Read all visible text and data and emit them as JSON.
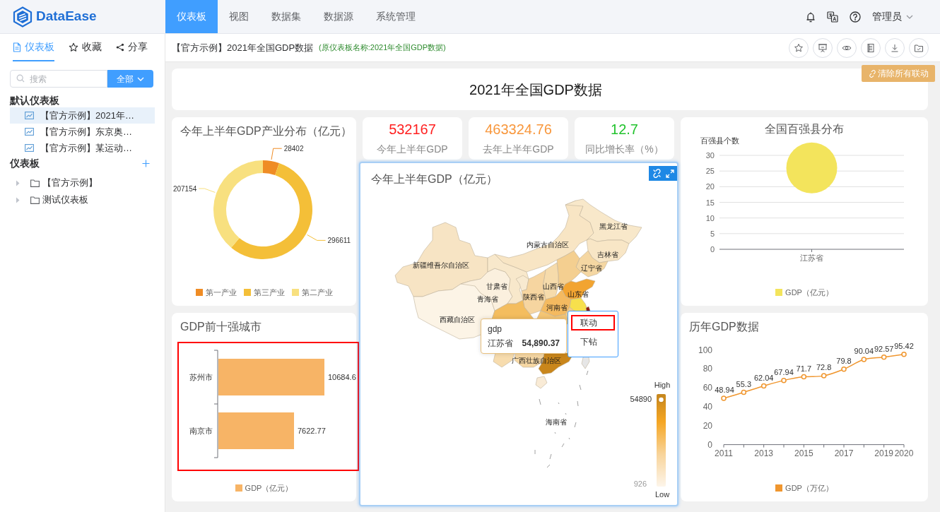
{
  "app": {
    "logo": "DataEase"
  },
  "nav": {
    "tabs": [
      {
        "label": "仪表板",
        "selected": true
      },
      {
        "label": "视图",
        "selected": false
      },
      {
        "label": "数据集",
        "selected": false
      },
      {
        "label": "数据源",
        "selected": false
      },
      {
        "label": "系统管理",
        "selected": false
      }
    ],
    "user": "管理员"
  },
  "sidebar": {
    "tabs": [
      {
        "label": "仪表板",
        "selected": true
      },
      {
        "label": "收藏",
        "selected": false
      },
      {
        "label": "分享",
        "selected": false
      }
    ],
    "search": {
      "placeholder": "搜索"
    },
    "filter_button": "全部",
    "default_section": {
      "title": "默认仪表板",
      "items": [
        {
          "label": "【官方示例】2021年…",
          "selected": true
        },
        {
          "label": "【官方示例】东京奥…",
          "selected": false
        },
        {
          "label": "【官方示例】某运动…",
          "selected": false
        }
      ]
    },
    "tree_section": {
      "title": "仪表板",
      "items": [
        {
          "label": "【官方示例】",
          "expanded": false
        },
        {
          "label": "测试仪表板",
          "expanded": false
        }
      ]
    }
  },
  "header": {
    "title": "【官方示例】2021年全国GDP数据",
    "original_name": "(原仪表板名称:2021年全国GDP数据)"
  },
  "dashboard": {
    "clear_linkage_button": "清除所有联动",
    "title": "2021年全国GDP数据",
    "kpis": [
      {
        "value": "532167",
        "label": "今年上半年GDP",
        "color": "#ff1f1f"
      },
      {
        "value": "463324.76",
        "label": "去年上半年GDP",
        "color": "#f8973c"
      },
      {
        "value": "12.7",
        "label": "同比增长率（%）",
        "color": "#22c32e"
      }
    ],
    "donut": {
      "chart_data": {
        "type": "donut",
        "title": "今年上半年GDP产业分布（亿元）",
        "categories": [
          "第一产业",
          "第三产业",
          "第二产业"
        ],
        "values": [
          28402,
          296611,
          207154
        ],
        "data_labels": true
      }
    },
    "county_chart": {
      "chart_data": {
        "type": "scatter",
        "title": "全国百强县分布",
        "ylabel": "百强县个数",
        "categories": [
          "江苏省"
        ],
        "series": [
          {
            "name": "GDP（亿元）",
            "color": "#f3e45c",
            "values": [
              26
            ]
          }
        ],
        "ylim": [
          0,
          30
        ],
        "yticks": [
          0,
          5,
          10,
          15,
          20,
          25,
          30
        ],
        "grid": true
      }
    },
    "map": {
      "title": "今年上半年GDP（亿元）",
      "selected": true,
      "regions": [
        {
          "label": "新疆维吾尔自治区",
          "color": "#f7e4c4"
        },
        {
          "label": "西藏自治区",
          "color": "#fcf4e6"
        },
        {
          "label": "青海省",
          "color": "#fbf0de"
        },
        {
          "label": "甘肃省",
          "color": "#f8e8cb"
        },
        {
          "label": "内蒙古自治区",
          "color": "#f8e5c4"
        },
        {
          "label": "黑龙江省",
          "color": "#f8e8ca"
        },
        {
          "label": "吉林省",
          "color": "#f8e6c6"
        },
        {
          "label": "辽宁省",
          "color": "#f5d7a2"
        },
        {
          "color": "#f4cf90"
        },
        {
          "color": "#f8ead0"
        },
        {
          "label": "山西省",
          "color": "#f6dbab"
        },
        {
          "label": "陕西省",
          "color": "#f6d5a0"
        },
        {
          "label": "山东省",
          "color": "#f2a431"
        },
        {
          "label": "河南省",
          "color": "#f4ba60"
        },
        {
          "color": "#f7e04c"
        },
        {
          "color": "#8c1c13"
        },
        {
          "color": "#f5cc85"
        },
        {
          "color": "#f5c674"
        },
        {
          "color": "#f4bd5e"
        },
        {
          "color": "#f7dcae"
        },
        {
          "label": "广西壮族自治区",
          "color": "#f6d7a3"
        },
        {
          "color": "#c9861b"
        },
        {
          "label": "海南省",
          "color": "#f9ebd6"
        },
        {
          "color": "#e6e6e6"
        }
      ],
      "visual_map": {
        "high": "High",
        "low": "Low",
        "max_label": "54890",
        "min_label": "926"
      },
      "tooltip": {
        "title": "gdp",
        "name": "江苏省",
        "value": "54,890.37"
      },
      "context_menu": [
        {
          "label": "联动",
          "highlighted": true
        },
        {
          "label": "下钻",
          "highlighted": false
        }
      ]
    },
    "city_bar": {
      "highlighted": true,
      "chart_data": {
        "type": "bar",
        "orientation": "horizontal",
        "title": "GDP前十强城市",
        "categories": [
          "苏州市",
          "南京市"
        ],
        "series": [
          {
            "name": "GDP（亿元）",
            "color": "#f7b466",
            "values": [
              10684.6,
              7622.77
            ]
          }
        ],
        "data_labels": true
      }
    },
    "history_line": {
      "chart_data": {
        "type": "line",
        "title": "历年GDP数据",
        "x": [
          2011,
          2012,
          2013,
          2014,
          2015,
          2016,
          2017,
          2018,
          2019,
          2020
        ],
        "series": [
          {
            "name": "GDP（万亿）",
            "color": "#f0962e",
            "marker": "circle",
            "values": [
              48.94,
              55.3,
              62.04,
              67.94,
              71.7,
              72.8,
              79.8,
              90.04,
              92.57,
              95.42
            ]
          }
        ],
        "xlim": [
          2011,
          2020
        ],
        "xticks": [
          2011,
          2013,
          2015,
          2017,
          2019,
          2020
        ],
        "ylim": [
          0,
          100
        ],
        "yticks": [
          0,
          20,
          40,
          60,
          80,
          100
        ],
        "data_labels": true
      }
    }
  }
}
